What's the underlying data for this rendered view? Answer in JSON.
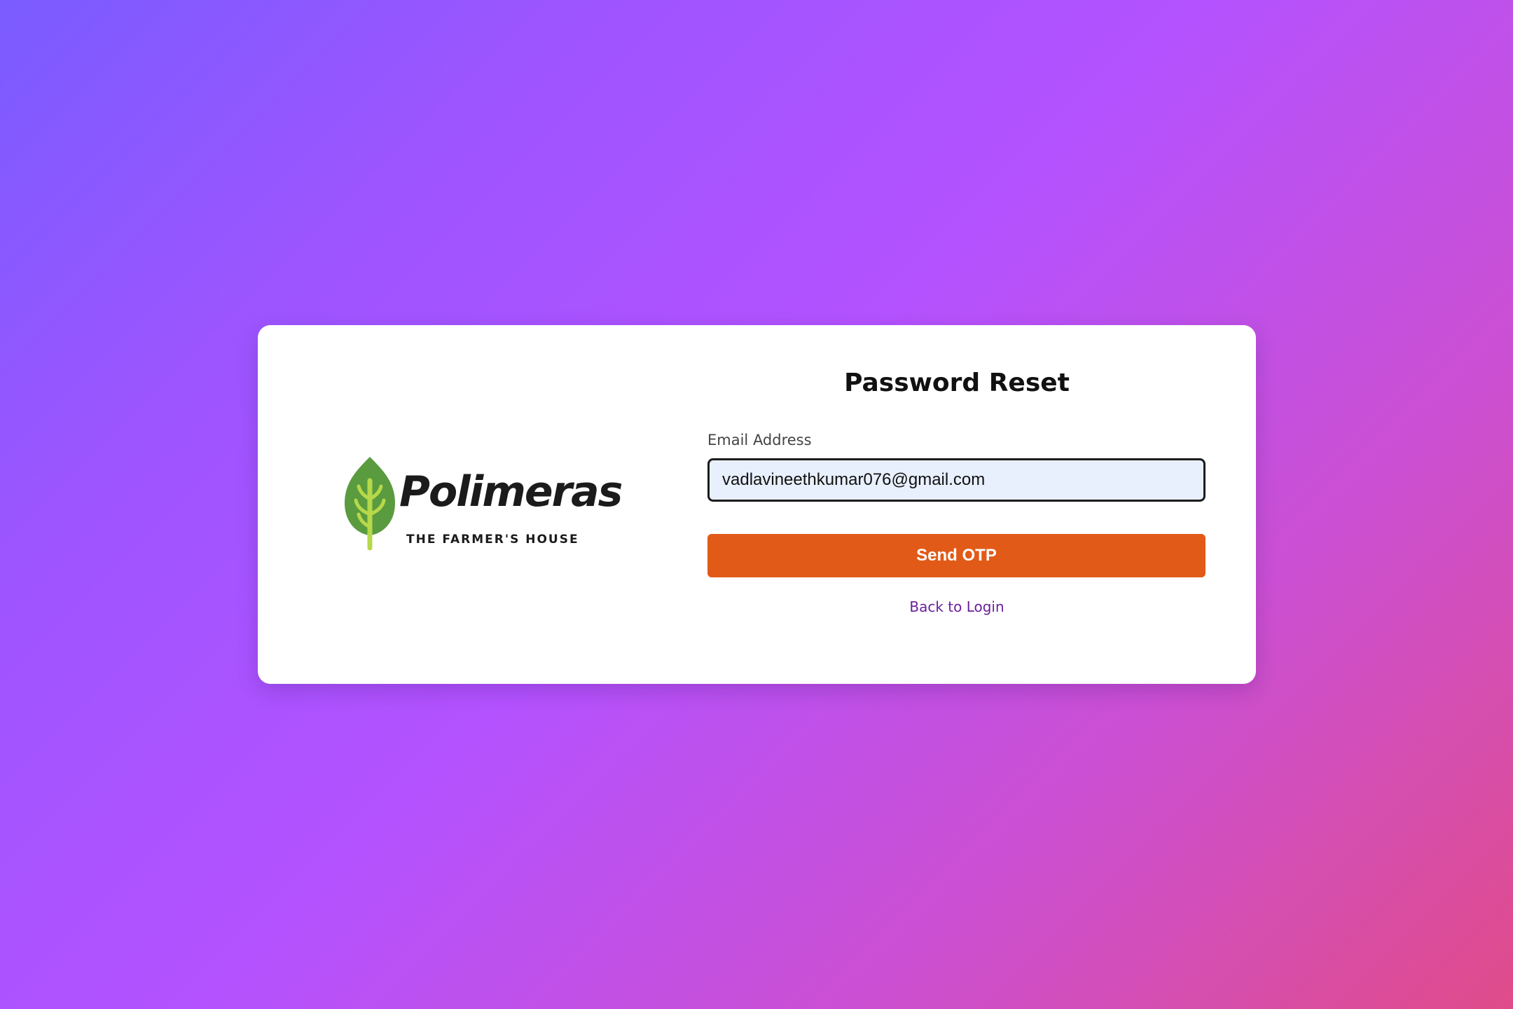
{
  "brand": {
    "logo_icon": "leaf-icon",
    "name": "Polimeras",
    "tagline": "THE FARMER'S HOUSE",
    "leaf_color": "#5a9b3f",
    "vein_color": "#b6d84a"
  },
  "form": {
    "title": "Password Reset",
    "email_label": "Email Address",
    "email_value": "vadlavineethkumar076@gmail.com",
    "send_button_label": "Send OTP",
    "back_link_label": "Back to Login"
  },
  "colors": {
    "accent_button": "#e25a17",
    "link": "#6a1f9a",
    "input_background": "#e8f0fe"
  }
}
